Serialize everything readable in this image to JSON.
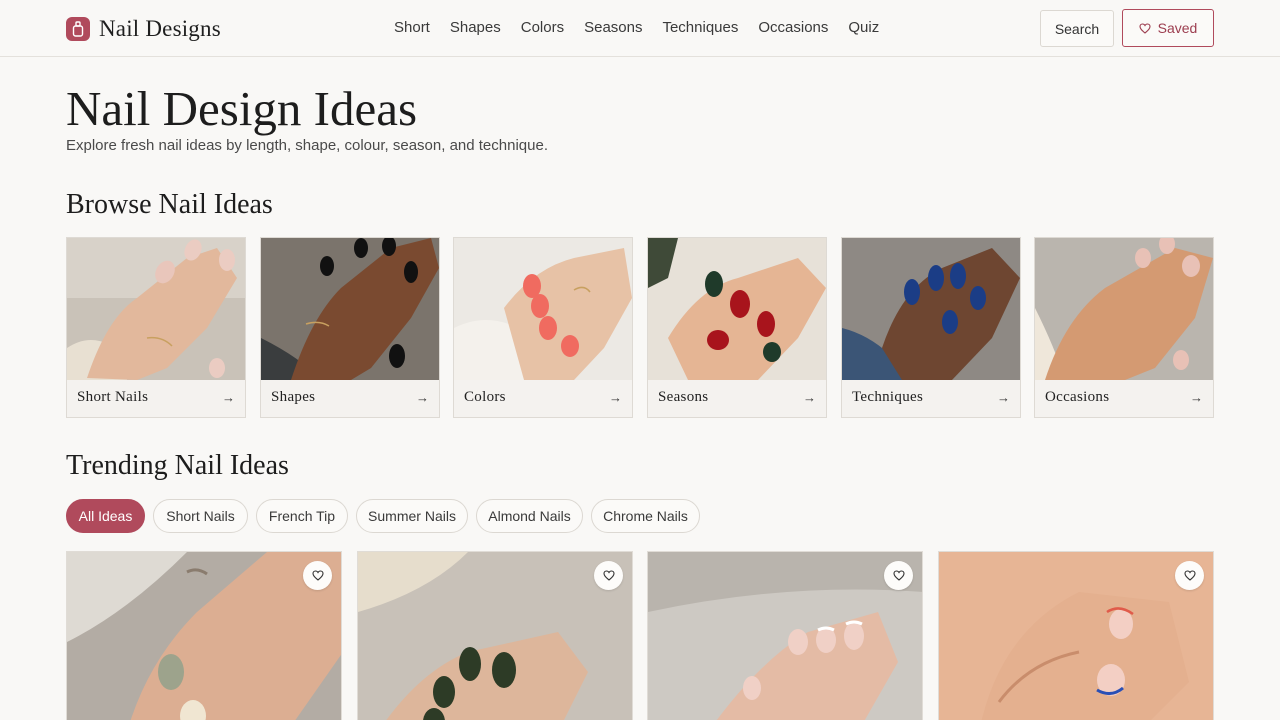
{
  "header": {
    "brand": "Nail Designs",
    "nav": [
      "Short",
      "Shapes",
      "Colors",
      "Seasons",
      "Techniques",
      "Occasions",
      "Quiz"
    ],
    "search_label": "Search",
    "saved_label": "Saved"
  },
  "hero": {
    "title": "Nail Design Ideas",
    "subtitle": "Explore fresh nail ideas by length, shape, colour, season, and technique."
  },
  "browse": {
    "title": "Browse Nail Ideas",
    "categories": [
      {
        "label": "Short Nails",
        "image": "short-nails-photo"
      },
      {
        "label": "Shapes",
        "image": "shapes-photo"
      },
      {
        "label": "Colors",
        "image": "colors-photo"
      },
      {
        "label": "Seasons",
        "image": "seasons-photo"
      },
      {
        "label": "Techniques",
        "image": "techniques-photo"
      },
      {
        "label": "Occasions",
        "image": "occasions-photo"
      }
    ],
    "arrow": "→"
  },
  "trending": {
    "title": "Trending Nail Ideas",
    "chips": [
      "All Ideas",
      "Short Nails",
      "French Tip",
      "Summer Nails",
      "Almond Nails",
      "Chrome Nails"
    ],
    "active_chip": "All Ideas",
    "cards": [
      {
        "image": "sage-cream-short-nails-photo"
      },
      {
        "image": "green-chrome-almond-nails-photo"
      },
      {
        "image": "white-french-tip-nails-photo"
      },
      {
        "image": "colorful-french-tip-nails-photo"
      }
    ]
  },
  "colors": {
    "accent": "#b04a5c",
    "background": "#f9f8f6"
  },
  "icons": {
    "logo": "nail-polish-bottle-icon",
    "saved": "heart-icon",
    "card_save": "heart-icon",
    "category_arrow": "arrow-right-icon"
  }
}
